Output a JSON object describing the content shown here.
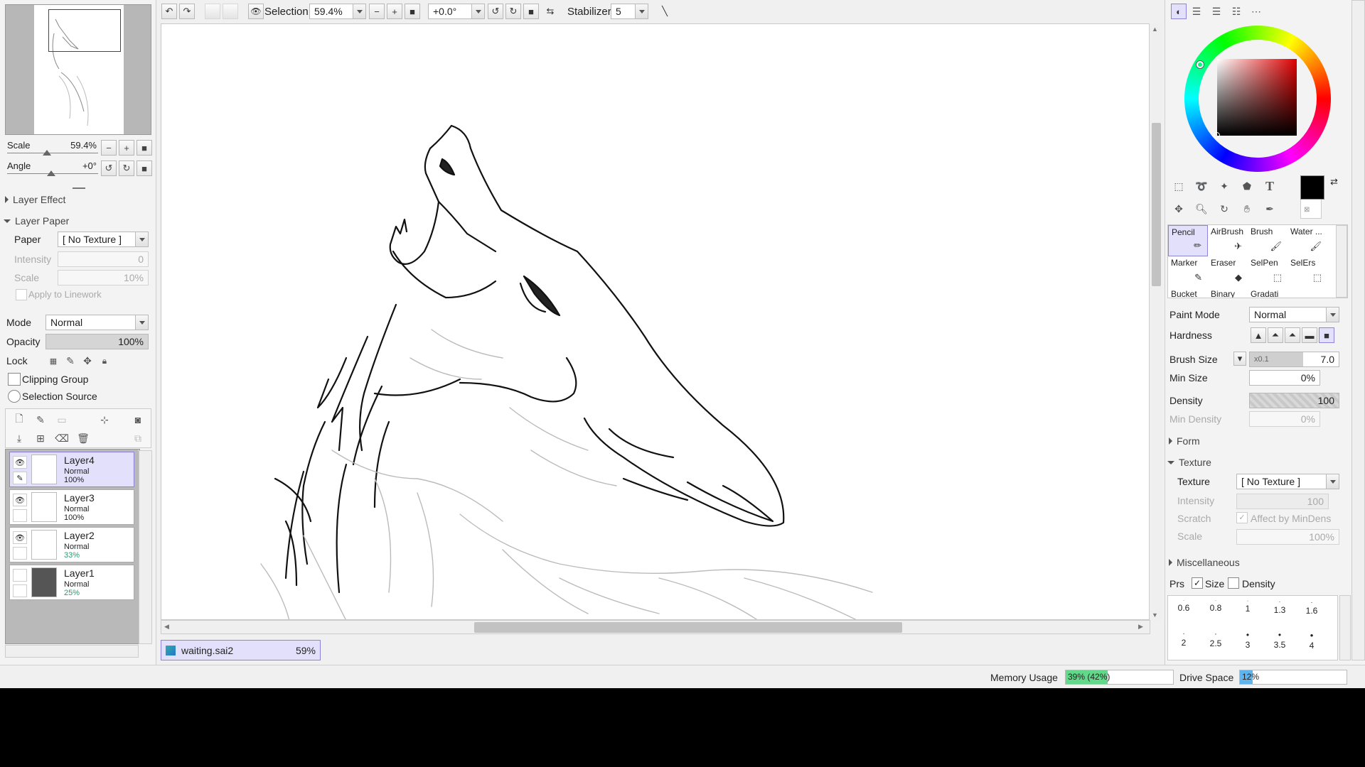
{
  "toolbar": {
    "selection_label": "Selection",
    "zoom_value": "59.4%",
    "angle_value": "+0.0°",
    "stabilizer_label": "Stabilizer",
    "stabilizer_value": "5"
  },
  "navigator": {
    "scale_label": "Scale",
    "scale_value": "59.4%",
    "angle_label": "Angle",
    "angle_value": "+0°"
  },
  "layer_props": {
    "layer_effect": "Layer Effect",
    "layer_paper": "Layer Paper",
    "paper_label": "Paper",
    "paper_value": "[ No Texture ]",
    "intensity_label": "Intensity",
    "intensity_value": "0",
    "scale_label": "Scale",
    "scale_value": "10%",
    "apply_linework": "Apply to Linework",
    "mode_label": "Mode",
    "mode_value": "Normal",
    "opacity_label": "Opacity",
    "opacity_value": "100%",
    "lock_label": "Lock",
    "clipping_group": "Clipping Group",
    "selection_source": "Selection Source"
  },
  "layers": [
    {
      "name": "Layer4",
      "mode": "Normal",
      "opacity": "100%"
    },
    {
      "name": "Layer3",
      "mode": "Normal",
      "opacity": "100%"
    },
    {
      "name": "Layer2",
      "mode": "Normal",
      "opacity": "33%"
    },
    {
      "name": "Layer1",
      "mode": "Normal",
      "opacity": "25%"
    }
  ],
  "document_tab": {
    "name": "waiting.sai2",
    "zoom": "59%"
  },
  "tools": [
    {
      "name": "Pencil"
    },
    {
      "name": "AirBrush"
    },
    {
      "name": "Brush"
    },
    {
      "name": "Water ..."
    },
    {
      "name": "Marker"
    },
    {
      "name": "Eraser"
    },
    {
      "name": "SelPen"
    },
    {
      "name": "SelErs"
    },
    {
      "name": "Bucket"
    },
    {
      "name": "Binary"
    },
    {
      "name": "Gradati"
    }
  ],
  "brush": {
    "paint_mode_label": "Paint Mode",
    "paint_mode_value": "Normal",
    "hardness_label": "Hardness",
    "brush_size_label": "Brush Size",
    "brush_size_mult": "x0.1",
    "brush_size_value": "7.0",
    "min_size_label": "Min Size",
    "min_size_value": "0%",
    "density_label": "Density",
    "density_value": "100",
    "min_density_label": "Min Density",
    "min_density_value": "0%",
    "form_label": "Form",
    "texture_section": "Texture",
    "texture_label": "Texture",
    "texture_value": "[ No Texture ]",
    "intensity_label": "Intensity",
    "intensity_value": "100",
    "scratch_label": "Scratch",
    "affect_label": "Affect by MinDens",
    "scale_label": "Scale",
    "scale_value": "100%",
    "misc_label": "Miscellaneous",
    "prs_label": "Prs",
    "prs_size": "Size",
    "prs_density": "Density"
  },
  "brush_sizes": [
    "0.6",
    "0.8",
    "1",
    "1.3",
    "1.6",
    "2",
    "2.5",
    "3",
    "3.5",
    "4"
  ],
  "status": {
    "memory_label": "Memory Usage",
    "memory_value": "39% (42%)",
    "memory_fraction": 0.39,
    "drive_label": "Drive Space",
    "drive_value": "12%",
    "drive_fraction": 0.12
  },
  "colors": {
    "accent": "#e3e0fb",
    "accent_border": "#8c84d6",
    "memory_fill": "#62d98a",
    "drive_fill": "#5fb4ee",
    "foreground_color": "#000000"
  }
}
